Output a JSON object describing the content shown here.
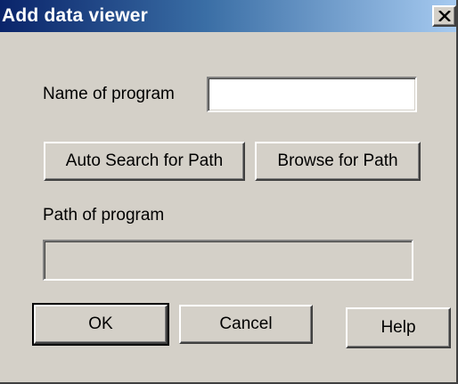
{
  "window": {
    "title": "Add data viewer",
    "close_label": "×",
    "colors": {
      "titlebar_start": "#0a246a",
      "titlebar_end": "#a6caf0",
      "face": "#d4d0c8"
    }
  },
  "form": {
    "name_label": "Name of program",
    "name_value": "",
    "path_label": "Path of program",
    "path_value": ""
  },
  "buttons": {
    "auto_search": "Auto Search for Path",
    "browse": "Browse for Path",
    "ok": "OK",
    "cancel": "Cancel",
    "help": "Help"
  },
  "icons": {
    "close": "close-icon"
  }
}
